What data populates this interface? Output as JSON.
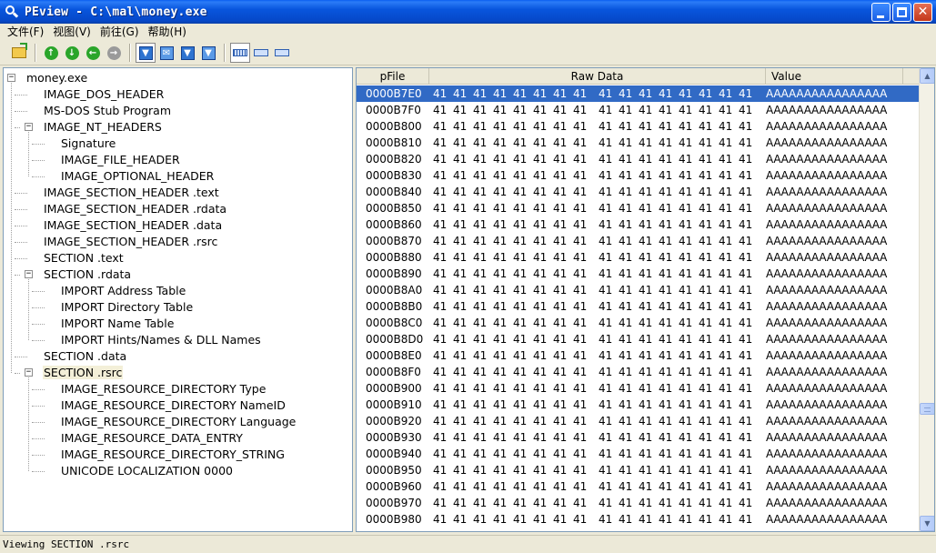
{
  "window": {
    "title": "PEview - C:\\mal\\money.exe"
  },
  "menu": [
    {
      "label": "文件(F)"
    },
    {
      "label": "视图(V)"
    },
    {
      "label": "前往(G)"
    },
    {
      "label": "帮助(H)"
    }
  ],
  "toolbar": {
    "buttons": [
      {
        "name": "open-file-icon",
        "glyph": ""
      },
      {
        "name": "go-back-icon",
        "glyph": "↑"
      },
      {
        "name": "go-forward-icon",
        "glyph": "↓"
      },
      {
        "name": "go-previous-icon",
        "glyph": "←"
      },
      {
        "name": "go-next-icon",
        "glyph": "→"
      },
      {
        "name": "view-hex-icon",
        "glyph": "▼"
      },
      {
        "name": "view-mail-icon",
        "glyph": "✉"
      },
      {
        "name": "view-down-icon",
        "glyph": "▼"
      },
      {
        "name": "view-down-alt-icon",
        "glyph": "▼"
      },
      {
        "name": "view-byte-icon",
        "glyph": ""
      },
      {
        "name": "view-word-icon",
        "glyph": ""
      },
      {
        "name": "view-dword-icon",
        "glyph": ""
      }
    ]
  },
  "tree": {
    "nodes": [
      {
        "label": "money.exe",
        "level": 0,
        "expander": "−"
      },
      {
        "label": "IMAGE_DOS_HEADER",
        "level": 1
      },
      {
        "label": "MS-DOS Stub Program",
        "level": 1
      },
      {
        "label": "IMAGE_NT_HEADERS",
        "level": 1,
        "expander": "−"
      },
      {
        "label": "Signature",
        "level": 2
      },
      {
        "label": "IMAGE_FILE_HEADER",
        "level": 2
      },
      {
        "label": "IMAGE_OPTIONAL_HEADER",
        "level": 2
      },
      {
        "label": "IMAGE_SECTION_HEADER .text",
        "level": 1
      },
      {
        "label": "IMAGE_SECTION_HEADER .rdata",
        "level": 1
      },
      {
        "label": "IMAGE_SECTION_HEADER .data",
        "level": 1
      },
      {
        "label": "IMAGE_SECTION_HEADER .rsrc",
        "level": 1
      },
      {
        "label": "SECTION .text",
        "level": 1
      },
      {
        "label": "SECTION .rdata",
        "level": 1,
        "expander": "−"
      },
      {
        "label": "IMPORT Address Table",
        "level": 2
      },
      {
        "label": "IMPORT Directory Table",
        "level": 2
      },
      {
        "label": "IMPORT Name Table",
        "level": 2
      },
      {
        "label": "IMPORT Hints/Names & DLL Names",
        "level": 2
      },
      {
        "label": "SECTION .data",
        "level": 1
      },
      {
        "label": "SECTION .rsrc",
        "level": 1,
        "expander": "−",
        "selected": true
      },
      {
        "label": "IMAGE_RESOURCE_DIRECTORY Type",
        "level": 2
      },
      {
        "label": "IMAGE_RESOURCE_DIRECTORY NameID",
        "level": 2
      },
      {
        "label": "IMAGE_RESOURCE_DIRECTORY Language",
        "level": 2
      },
      {
        "label": "IMAGE_RESOURCE_DATA_ENTRY",
        "level": 2
      },
      {
        "label": "IMAGE_RESOURCE_DIRECTORY_STRING",
        "level": 2
      },
      {
        "label": "UNICODE  LOCALIZATION  0000",
        "level": 2
      }
    ]
  },
  "grid": {
    "headers": {
      "pfile": "pFile",
      "raw": "Raw Data",
      "value": "Value"
    },
    "rows": [
      {
        "offset": "0000B7E0",
        "raw": [
          "41",
          "41",
          "41",
          "41",
          "41",
          "41",
          "41",
          "41",
          "41",
          "41",
          "41",
          "41",
          "41",
          "41",
          "41",
          "41"
        ],
        "value": "AAAAAAAAAAAAAAAA",
        "selected": true
      },
      {
        "offset": "0000B7F0",
        "raw": [
          "41",
          "41",
          "41",
          "41",
          "41",
          "41",
          "41",
          "41",
          "41",
          "41",
          "41",
          "41",
          "41",
          "41",
          "41",
          "41"
        ],
        "value": "AAAAAAAAAAAAAAAA"
      },
      {
        "offset": "0000B800",
        "raw": [
          "41",
          "41",
          "41",
          "41",
          "41",
          "41",
          "41",
          "41",
          "41",
          "41",
          "41",
          "41",
          "41",
          "41",
          "41",
          "41"
        ],
        "value": "AAAAAAAAAAAAAAAA"
      },
      {
        "offset": "0000B810",
        "raw": [
          "41",
          "41",
          "41",
          "41",
          "41",
          "41",
          "41",
          "41",
          "41",
          "41",
          "41",
          "41",
          "41",
          "41",
          "41",
          "41"
        ],
        "value": "AAAAAAAAAAAAAAAA"
      },
      {
        "offset": "0000B820",
        "raw": [
          "41",
          "41",
          "41",
          "41",
          "41",
          "41",
          "41",
          "41",
          "41",
          "41",
          "41",
          "41",
          "41",
          "41",
          "41",
          "41"
        ],
        "value": "AAAAAAAAAAAAAAAA"
      },
      {
        "offset": "0000B830",
        "raw": [
          "41",
          "41",
          "41",
          "41",
          "41",
          "41",
          "41",
          "41",
          "41",
          "41",
          "41",
          "41",
          "41",
          "41",
          "41",
          "41"
        ],
        "value": "AAAAAAAAAAAAAAAA"
      },
      {
        "offset": "0000B840",
        "raw": [
          "41",
          "41",
          "41",
          "41",
          "41",
          "41",
          "41",
          "41",
          "41",
          "41",
          "41",
          "41",
          "41",
          "41",
          "41",
          "41"
        ],
        "value": "AAAAAAAAAAAAAAAA"
      },
      {
        "offset": "0000B850",
        "raw": [
          "41",
          "41",
          "41",
          "41",
          "41",
          "41",
          "41",
          "41",
          "41",
          "41",
          "41",
          "41",
          "41",
          "41",
          "41",
          "41"
        ],
        "value": "AAAAAAAAAAAAAAAA"
      },
      {
        "offset": "0000B860",
        "raw": [
          "41",
          "41",
          "41",
          "41",
          "41",
          "41",
          "41",
          "41",
          "41",
          "41",
          "41",
          "41",
          "41",
          "41",
          "41",
          "41"
        ],
        "value": "AAAAAAAAAAAAAAAA"
      },
      {
        "offset": "0000B870",
        "raw": [
          "41",
          "41",
          "41",
          "41",
          "41",
          "41",
          "41",
          "41",
          "41",
          "41",
          "41",
          "41",
          "41",
          "41",
          "41",
          "41"
        ],
        "value": "AAAAAAAAAAAAAAAA"
      },
      {
        "offset": "0000B880",
        "raw": [
          "41",
          "41",
          "41",
          "41",
          "41",
          "41",
          "41",
          "41",
          "41",
          "41",
          "41",
          "41",
          "41",
          "41",
          "41",
          "41"
        ],
        "value": "AAAAAAAAAAAAAAAA"
      },
      {
        "offset": "0000B890",
        "raw": [
          "41",
          "41",
          "41",
          "41",
          "41",
          "41",
          "41",
          "41",
          "41",
          "41",
          "41",
          "41",
          "41",
          "41",
          "41",
          "41"
        ],
        "value": "AAAAAAAAAAAAAAAA"
      },
      {
        "offset": "0000B8A0",
        "raw": [
          "41",
          "41",
          "41",
          "41",
          "41",
          "41",
          "41",
          "41",
          "41",
          "41",
          "41",
          "41",
          "41",
          "41",
          "41",
          "41"
        ],
        "value": "AAAAAAAAAAAAAAAA"
      },
      {
        "offset": "0000B8B0",
        "raw": [
          "41",
          "41",
          "41",
          "41",
          "41",
          "41",
          "41",
          "41",
          "41",
          "41",
          "41",
          "41",
          "41",
          "41",
          "41",
          "41"
        ],
        "value": "AAAAAAAAAAAAAAAA"
      },
      {
        "offset": "0000B8C0",
        "raw": [
          "41",
          "41",
          "41",
          "41",
          "41",
          "41",
          "41",
          "41",
          "41",
          "41",
          "41",
          "41",
          "41",
          "41",
          "41",
          "41"
        ],
        "value": "AAAAAAAAAAAAAAAA"
      },
      {
        "offset": "0000B8D0",
        "raw": [
          "41",
          "41",
          "41",
          "41",
          "41",
          "41",
          "41",
          "41",
          "41",
          "41",
          "41",
          "41",
          "41",
          "41",
          "41",
          "41"
        ],
        "value": "AAAAAAAAAAAAAAAA"
      },
      {
        "offset": "0000B8E0",
        "raw": [
          "41",
          "41",
          "41",
          "41",
          "41",
          "41",
          "41",
          "41",
          "41",
          "41",
          "41",
          "41",
          "41",
          "41",
          "41",
          "41"
        ],
        "value": "AAAAAAAAAAAAAAAA"
      },
      {
        "offset": "0000B8F0",
        "raw": [
          "41",
          "41",
          "41",
          "41",
          "41",
          "41",
          "41",
          "41",
          "41",
          "41",
          "41",
          "41",
          "41",
          "41",
          "41",
          "41"
        ],
        "value": "AAAAAAAAAAAAAAAA"
      },
      {
        "offset": "0000B900",
        "raw": [
          "41",
          "41",
          "41",
          "41",
          "41",
          "41",
          "41",
          "41",
          "41",
          "41",
          "41",
          "41",
          "41",
          "41",
          "41",
          "41"
        ],
        "value": "AAAAAAAAAAAAAAAA"
      },
      {
        "offset": "0000B910",
        "raw": [
          "41",
          "41",
          "41",
          "41",
          "41",
          "41",
          "41",
          "41",
          "41",
          "41",
          "41",
          "41",
          "41",
          "41",
          "41",
          "41"
        ],
        "value": "AAAAAAAAAAAAAAAA"
      },
      {
        "offset": "0000B920",
        "raw": [
          "41",
          "41",
          "41",
          "41",
          "41",
          "41",
          "41",
          "41",
          "41",
          "41",
          "41",
          "41",
          "41",
          "41",
          "41",
          "41"
        ],
        "value": "AAAAAAAAAAAAAAAA"
      },
      {
        "offset": "0000B930",
        "raw": [
          "41",
          "41",
          "41",
          "41",
          "41",
          "41",
          "41",
          "41",
          "41",
          "41",
          "41",
          "41",
          "41",
          "41",
          "41",
          "41"
        ],
        "value": "AAAAAAAAAAAAAAAA"
      },
      {
        "offset": "0000B940",
        "raw": [
          "41",
          "41",
          "41",
          "41",
          "41",
          "41",
          "41",
          "41",
          "41",
          "41",
          "41",
          "41",
          "41",
          "41",
          "41",
          "41"
        ],
        "value": "AAAAAAAAAAAAAAAA"
      },
      {
        "offset": "0000B950",
        "raw": [
          "41",
          "41",
          "41",
          "41",
          "41",
          "41",
          "41",
          "41",
          "41",
          "41",
          "41",
          "41",
          "41",
          "41",
          "41",
          "41"
        ],
        "value": "AAAAAAAAAAAAAAAA"
      },
      {
        "offset": "0000B960",
        "raw": [
          "41",
          "41",
          "41",
          "41",
          "41",
          "41",
          "41",
          "41",
          "41",
          "41",
          "41",
          "41",
          "41",
          "41",
          "41",
          "41"
        ],
        "value": "AAAAAAAAAAAAAAAA"
      },
      {
        "offset": "0000B970",
        "raw": [
          "41",
          "41",
          "41",
          "41",
          "41",
          "41",
          "41",
          "41",
          "41",
          "41",
          "41",
          "41",
          "41",
          "41",
          "41",
          "41"
        ],
        "value": "AAAAAAAAAAAAAAAA"
      },
      {
        "offset": "0000B980",
        "raw": [
          "41",
          "41",
          "41",
          "41",
          "41",
          "41",
          "41",
          "41",
          "41",
          "41",
          "41",
          "41",
          "41",
          "41",
          "41",
          "41"
        ],
        "value": "AAAAAAAAAAAAAAAA"
      }
    ],
    "scroll_position": 0.76
  },
  "status": {
    "text": "Viewing SECTION .rsrc"
  }
}
